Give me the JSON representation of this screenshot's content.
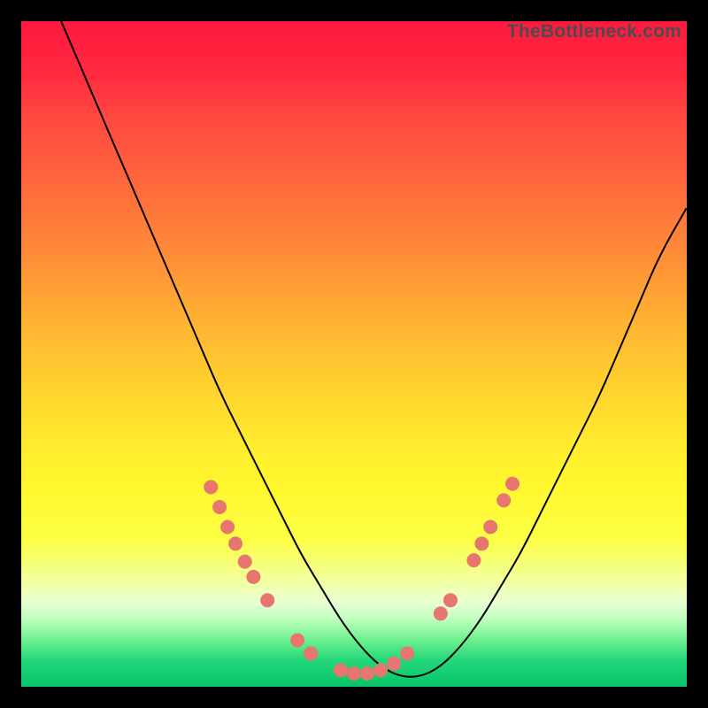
{
  "watermark": "TheBottleneck.com",
  "colors": {
    "curve_stroke": "#000000",
    "dot_fill": "#e77570",
    "dot_stroke": "#c65a56",
    "frame_bg_top": "#ff183f",
    "frame_bg_bottom": "#09c46a"
  },
  "chart_data": {
    "type": "line",
    "title": "",
    "xlabel": "",
    "ylabel": "",
    "xlim": [
      0,
      100
    ],
    "ylim": [
      0,
      100
    ],
    "series": [
      {
        "name": "bottleneck-curve",
        "x": [
          6,
          9,
          12,
          15,
          18,
          21,
          24,
          27,
          30,
          33,
          36,
          39,
          42,
          45,
          48,
          51,
          54,
          57,
          60,
          63,
          66,
          69,
          72,
          75,
          78,
          81,
          84,
          87,
          90,
          93,
          96,
          100
        ],
        "y": [
          100,
          93,
          86,
          79,
          72,
          65,
          58,
          51,
          44,
          38,
          32,
          26,
          20,
          15,
          10,
          6,
          3,
          1.5,
          1.5,
          3,
          6,
          10,
          15,
          20,
          26,
          32,
          38,
          44,
          51,
          58,
          65,
          72
        ]
      }
    ],
    "markers": {
      "name": "highlight-dots",
      "points": [
        {
          "x": 28.5,
          "y": 30.0
        },
        {
          "x": 29.8,
          "y": 27.0
        },
        {
          "x": 31.0,
          "y": 24.0
        },
        {
          "x": 32.2,
          "y": 21.5
        },
        {
          "x": 33.6,
          "y": 18.8
        },
        {
          "x": 34.9,
          "y": 16.5
        },
        {
          "x": 37.0,
          "y": 13.0
        },
        {
          "x": 41.5,
          "y": 7.0
        },
        {
          "x": 43.5,
          "y": 5.0
        },
        {
          "x": 48.0,
          "y": 2.5
        },
        {
          "x": 50.0,
          "y": 2.0
        },
        {
          "x": 52.0,
          "y": 2.0
        },
        {
          "x": 54.0,
          "y": 2.5
        },
        {
          "x": 56.0,
          "y": 3.5
        },
        {
          "x": 58.0,
          "y": 5.0
        },
        {
          "x": 63.0,
          "y": 11.0
        },
        {
          "x": 64.5,
          "y": 13.0
        },
        {
          "x": 68.0,
          "y": 19.0
        },
        {
          "x": 69.2,
          "y": 21.5
        },
        {
          "x": 70.5,
          "y": 24.0
        },
        {
          "x": 72.5,
          "y": 28.0
        },
        {
          "x": 73.8,
          "y": 30.5
        }
      ]
    }
  }
}
